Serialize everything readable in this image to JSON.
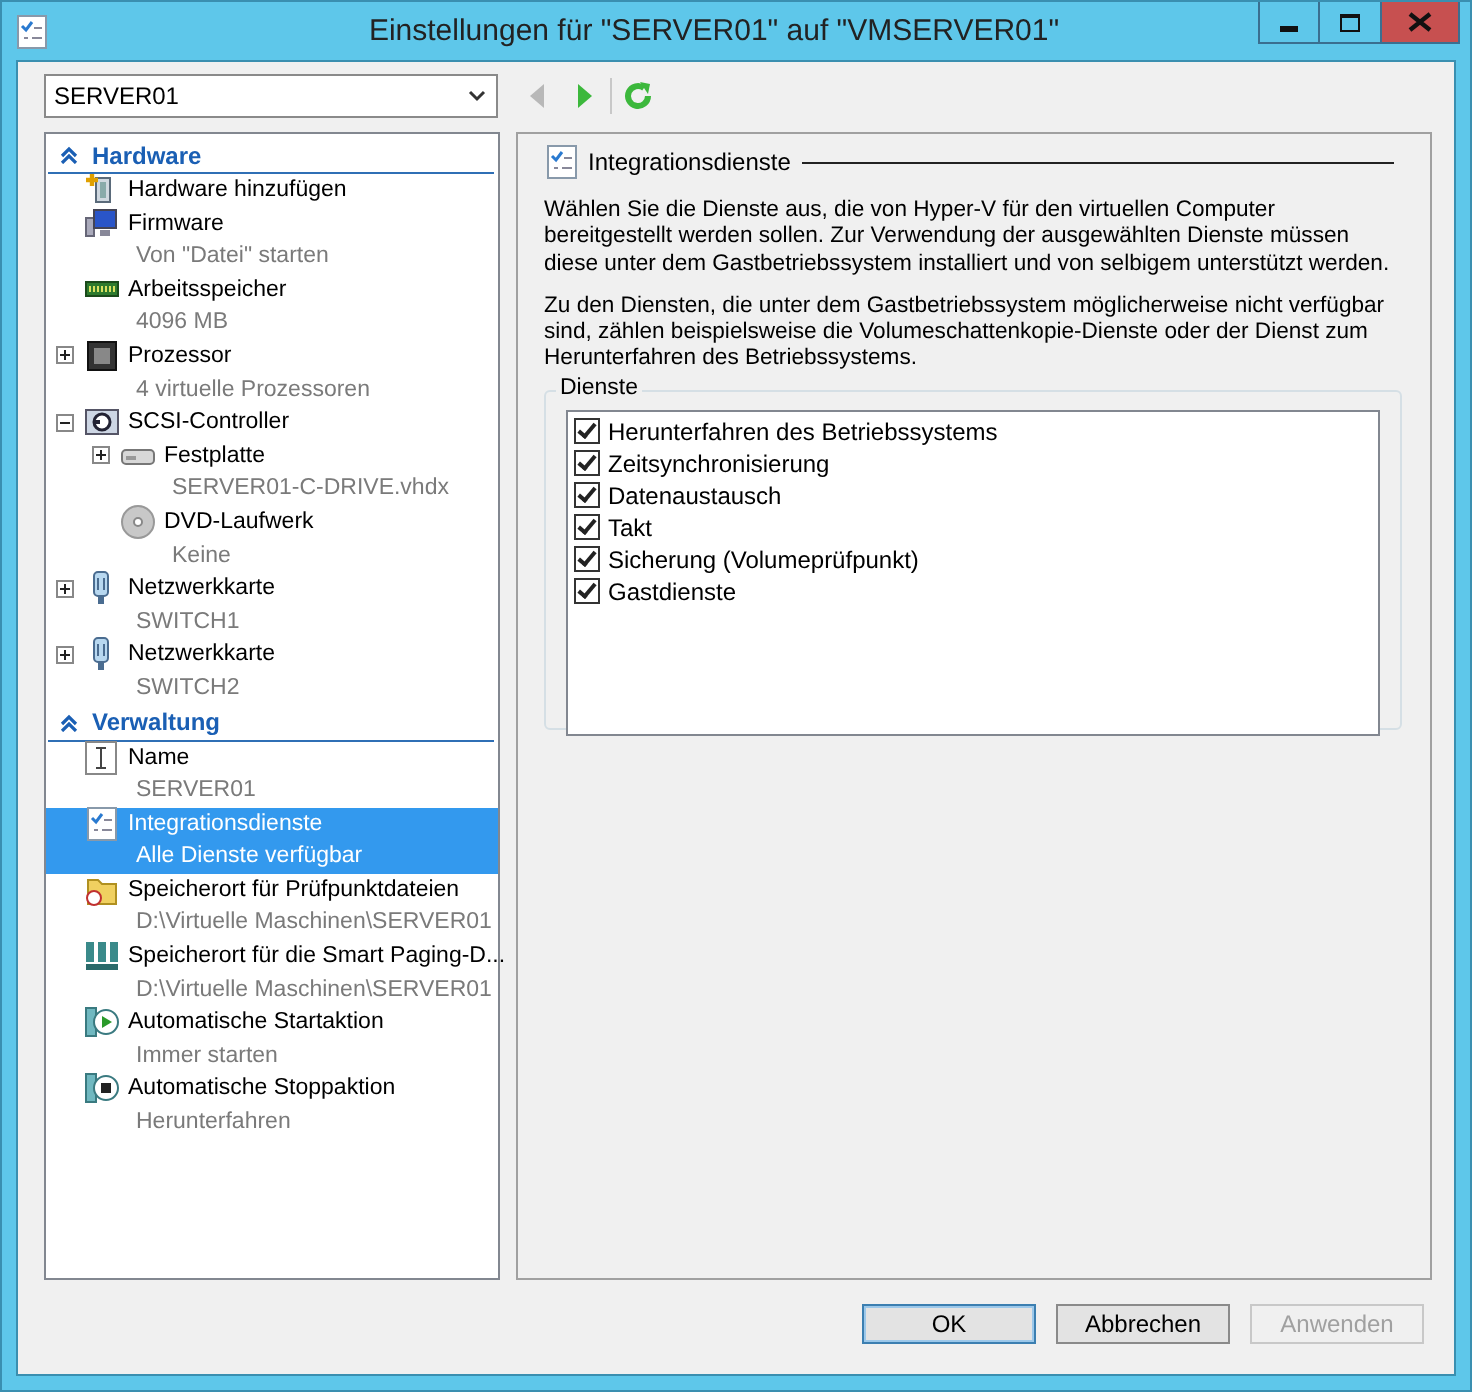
{
  "window": {
    "title": "Einstellungen für \"SERVER01\" auf \"VMSERVER01\""
  },
  "vm_selector": {
    "value": "SERVER01"
  },
  "navigation": [
    {
      "kind": "back",
      "disabled": true
    },
    {
      "kind": "forward",
      "disabled": false
    },
    {
      "kind": "refresh",
      "disabled": false
    }
  ],
  "tree": [
    {
      "title": "Hardware",
      "expanded": true,
      "items": [
        {
          "kind": "add-hardware",
          "name": "Hardware hinzufügen",
          "selected": false
        },
        {
          "kind": "firmware",
          "name": "Firmware",
          "sub": "Von \"Datei\" starten",
          "selected": false
        },
        {
          "kind": "memory",
          "name": "Arbeitsspeicher",
          "sub": "4096 MB",
          "selected": false
        },
        {
          "kind": "processor",
          "name": "Prozessor",
          "sub": "4 virtuelle Prozessoren",
          "expanded": false,
          "selected": false
        },
        {
          "kind": "controller",
          "name": "SCSI-Controller",
          "expanded": true,
          "selected": false,
          "children": [
            {
              "kind": "disk",
              "name": "Festplatte",
              "sub": "SERVER01-C-DRIVE.vhdx",
              "expanded": false,
              "selected": false
            },
            {
              "kind": "dvd",
              "name": "DVD-Laufwerk",
              "sub": "Keine",
              "selected": false
            }
          ]
        },
        {
          "kind": "network",
          "name": "Netzwerkkarte",
          "sub": "SWITCH1",
          "expanded": false,
          "selected": false
        },
        {
          "kind": "network",
          "name": "Netzwerkkarte",
          "sub": "SWITCH2",
          "expanded": false,
          "selected": false
        }
      ]
    },
    {
      "title": "Verwaltung",
      "expanded": true,
      "items": [
        {
          "kind": "name",
          "name": "Name",
          "sub": "SERVER01",
          "selected": false
        },
        {
          "kind": "services",
          "name": "Integrationsdienste",
          "sub": "Alle Dienste verfügbar",
          "selected": true
        },
        {
          "kind": "checkpoint",
          "name": "Speicherort für Prüfpunktdateien",
          "sub": "D:\\Virtuelle Maschinen\\SERVER01",
          "selected": false
        },
        {
          "kind": "paging",
          "name": "Speicherort für die Smart Paging-D...",
          "sub": "D:\\Virtuelle Maschinen\\SERVER01",
          "selected": false
        },
        {
          "kind": "start",
          "name": "Automatische Startaktion",
          "sub": "Immer starten",
          "selected": false
        },
        {
          "kind": "stop",
          "name": "Automatische Stoppaktion",
          "sub": "Herunterfahren",
          "selected": false
        }
      ]
    }
  ],
  "panel": {
    "title": "Integrationsdienste",
    "paragraphs": [
      "Wählen Sie die Dienste aus, die von Hyper-V für den virtuellen Computer bereitgestellt werden sollen. Zur Verwendung der ausgewählten Dienste müssen diese unter dem Gastbetriebssystem installiert und von selbigem unterstützt werden.",
      "Zu den Diensten, die unter dem Gastbetriebssystem möglicherweise nicht verfügbar sind, zählen beispielsweise die Volumeschattenkopie-Dienste oder der Dienst zum Herunterfahren des Betriebssystems."
    ],
    "group": {
      "title": "Dienste",
      "services": [
        {
          "label": "Herunterfahren des Betriebssystems",
          "checked": true
        },
        {
          "label": "Zeitsynchronisierung",
          "checked": true
        },
        {
          "label": "Datenaustausch",
          "checked": true
        },
        {
          "label": "Takt",
          "checked": true
        },
        {
          "label": "Sicherung (Volumeprüfpunkt)",
          "checked": true
        },
        {
          "label": "Gastdienste",
          "checked": true
        }
      ]
    }
  },
  "buttons": [
    {
      "label": "OK",
      "default": true,
      "disabled": false
    },
    {
      "label": "Abbrechen",
      "default": false,
      "disabled": false
    },
    {
      "label": "Anwenden",
      "default": false,
      "disabled": true
    }
  ]
}
